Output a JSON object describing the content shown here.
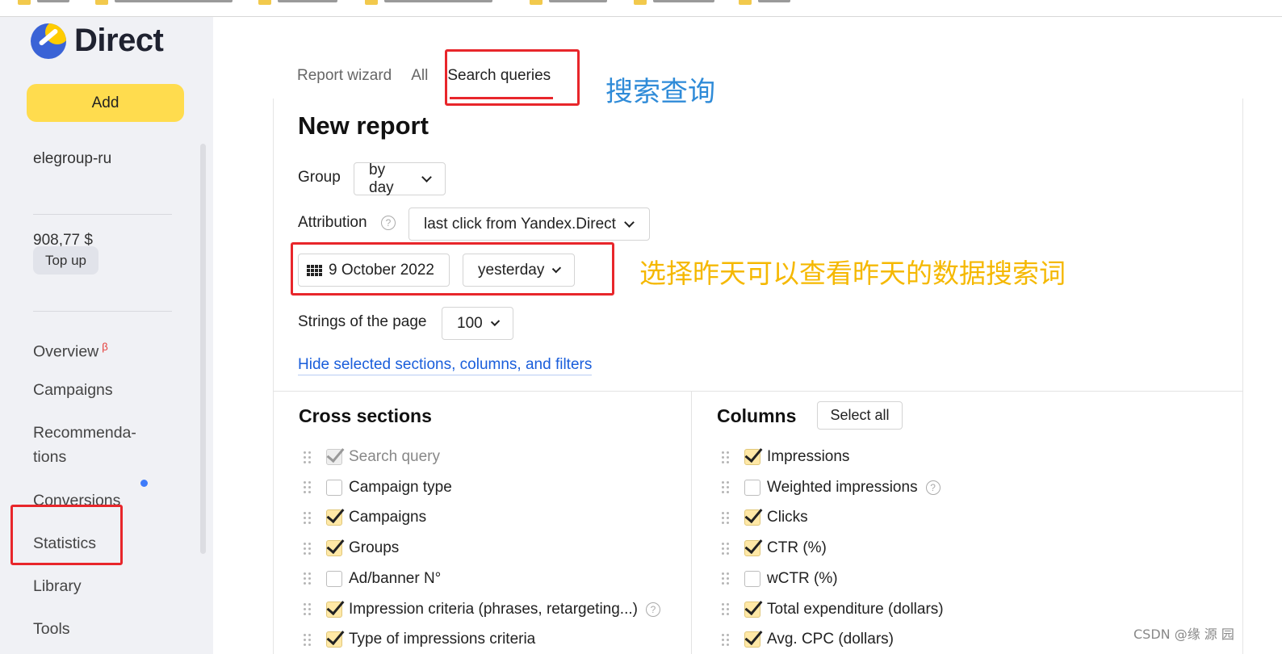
{
  "sidebar": {
    "logo_text": "Direct",
    "add_label": "Add",
    "account": "elegroup-ru",
    "balance": "908,77 $",
    "topup_label": "Top up",
    "nav": {
      "overview": "Overview",
      "overview_badge": "β",
      "campaigns": "Campaigns",
      "recommendations_1": "Recommenda-",
      "recommendations_2": "tions",
      "conversions": "Conversions",
      "statistics": "Statistics",
      "library": "Library",
      "tools": "Tools"
    }
  },
  "tabs": [
    "Report wizard",
    "All",
    "Search queries"
  ],
  "annotations": {
    "search_queries_cn": "搜索查询",
    "yesterday_cn": "选择昨天可以查看昨天的数据搜索词"
  },
  "report": {
    "title": "New report",
    "group_label": "Group",
    "group_value": "by day",
    "attribution_label": "Attribution",
    "attribution_value": "last click from Yandex.Direct",
    "help_glyph": "?",
    "date_value": "9 October 2022",
    "period_value": "yesterday",
    "strings_label": "Strings of the page",
    "strings_value": "100",
    "hide_link": "Hide selected sections, columns, and filters"
  },
  "cross_sections": {
    "title": "Cross sections",
    "items": [
      {
        "label": "Search query",
        "state": "disabled"
      },
      {
        "label": "Campaign type",
        "state": "off"
      },
      {
        "label": "Campaigns",
        "state": "on"
      },
      {
        "label": "Groups",
        "state": "on"
      },
      {
        "label": "Ad/banner N°",
        "state": "off"
      },
      {
        "label": "Impression criteria (phrases, retargeting...)",
        "state": "on",
        "help": true
      },
      {
        "label": "Type of impressions criteria",
        "state": "on"
      }
    ]
  },
  "columns": {
    "title": "Columns",
    "select_all": "Select all",
    "items": [
      {
        "label": "Impressions",
        "state": "on"
      },
      {
        "label": "Weighted impressions",
        "state": "off",
        "help": true
      },
      {
        "label": "Clicks",
        "state": "on"
      },
      {
        "label": "CTR (%)",
        "state": "on"
      },
      {
        "label": "wCTR (%)",
        "state": "off"
      },
      {
        "label": "Total expenditure (dollars)",
        "state": "on"
      },
      {
        "label": "Avg. CPC (dollars)",
        "state": "on"
      }
    ]
  },
  "watermark": "CSDN @缘  源  园"
}
